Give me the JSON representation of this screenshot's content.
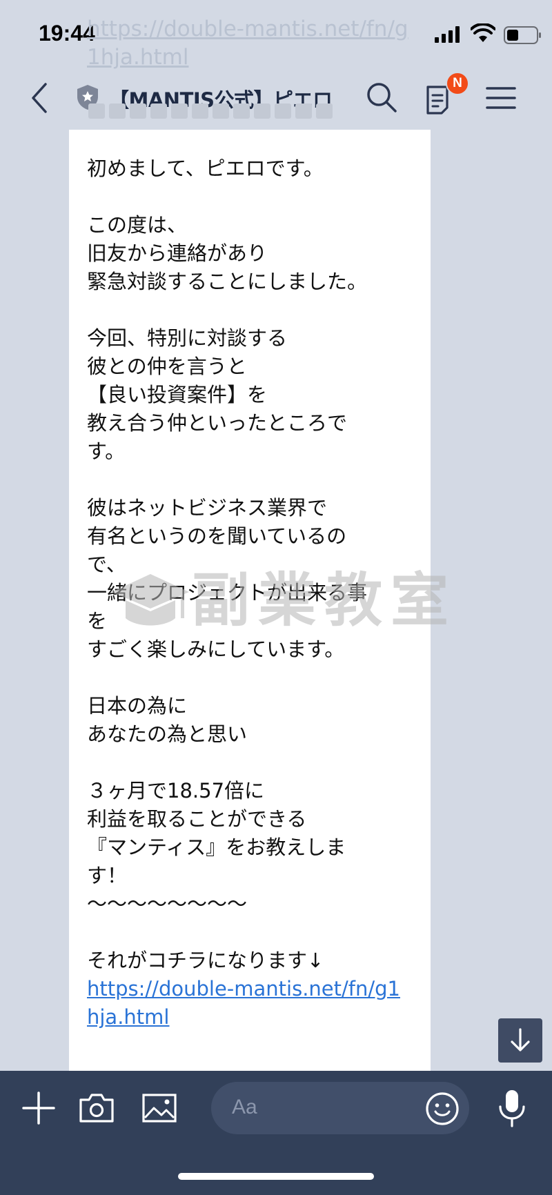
{
  "status_bar": {
    "time": "19:44"
  },
  "ghost_link": "https://double-mantis.net/fn/g1hja.html",
  "header": {
    "title": "【MANTIS公式】ピエロ",
    "badge": "N"
  },
  "message": {
    "text": "初めまして、ピエロです。\n\nこの度は、\n旧友から連絡があり\n緊急対談することにしました。\n\n今回、特別に対談する\n彼との仲を言うと\n【良い投資案件】を\n教え合う仲といったところで\nす。\n\n彼はネットビジネス業界で\n有名というのを聞いているの\nで、\n一緒にプロジェクトが出来る事\nを\nすごく楽しみにしています。\n\n日本の為に\nあなたの為と思い\n\n３ヶ月で18.57倍に\n利益を取ることができる\n『マンティス』をお教えしま\nす！\n〜〜〜〜〜〜〜〜\n\nそれがコチラになります↓\n",
    "link": "https://double-mantis.net/fn/g1hja.html"
  },
  "watermark": {
    "text": "副業教室"
  },
  "input": {
    "placeholder": "Aa"
  },
  "colors": {
    "chat_background": "#d3d9e4",
    "bottom_bar": "#324059",
    "badge": "#f24b18",
    "link": "#2a73d6"
  },
  "icons": [
    "back-arrow-icon",
    "shield-icon",
    "search-icon",
    "notes-icon",
    "menu-icon",
    "chevron-down-icon",
    "plus-icon",
    "camera-icon",
    "image-icon",
    "emoji-icon",
    "microphone-icon"
  ]
}
